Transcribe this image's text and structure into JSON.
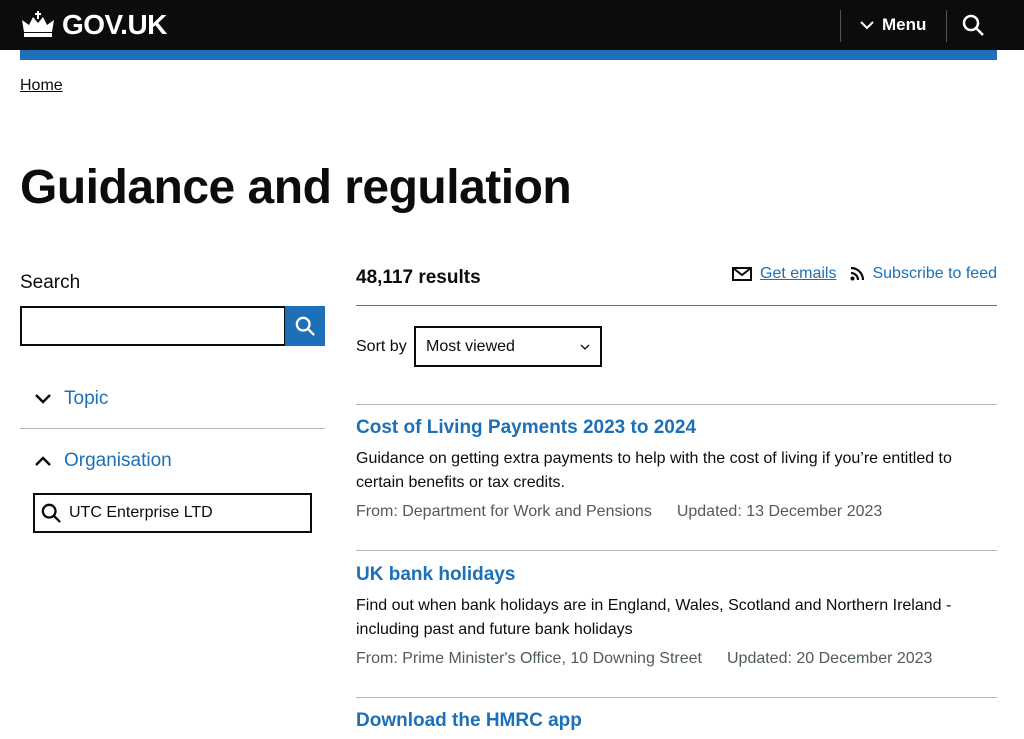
{
  "header": {
    "logo": "GOV.UK",
    "menu_label": "Menu"
  },
  "breadcrumb": {
    "home": "Home"
  },
  "page_title": "Guidance and regulation",
  "sidebar": {
    "search_label": "Search",
    "search_value": "",
    "facets": [
      {
        "label": "Topic",
        "expanded": false
      },
      {
        "label": "Organisation",
        "expanded": true
      }
    ],
    "selected_organisation": "UTC Enterprise LTD"
  },
  "results": {
    "count": "48,117 results",
    "get_emails": "Get emails",
    "subscribe": "Subscribe to feed",
    "sort_label": "Sort by",
    "sort_value": "Most viewed",
    "items": [
      {
        "title": "Cost of Living Payments 2023 to 2024",
        "description": "Guidance on getting extra payments to help with the cost of living if you’re entitled to certain benefits or tax credits.",
        "from": "From: Department for Work and Pensions",
        "updated": "Updated: 13 December 2023"
      },
      {
        "title": "UK bank holidays",
        "description": "Find out when bank holidays are in England, Wales, Scotland and Northern Ireland - including past and future bank holidays",
        "from": "From: Prime Minister's Office, 10 Downing Street",
        "updated": "Updated: 20 December 2023"
      },
      {
        "title": "Download the HMRC app"
      }
    ]
  },
  "colors": {
    "header": "#0b0c0c",
    "brand_blue": "#1d70b8",
    "link": "#1d70b8"
  }
}
